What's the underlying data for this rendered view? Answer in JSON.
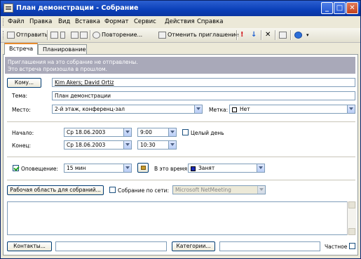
{
  "window": {
    "title": "План демонстрации - Собрание",
    "controls": [
      "_",
      "□",
      "✕"
    ]
  },
  "menu": [
    "Файл",
    "Правка",
    "Вид",
    "Вставка",
    "Формат",
    "Сервис",
    "Действия",
    "Справка"
  ],
  "toolbar": {
    "send": "Отправить",
    "recurrence": "Повторение...",
    "cancel_invite": "Отменить приглашение"
  },
  "tabs": [
    "Встреча",
    "Планирование"
  ],
  "infobar": {
    "line1": "Приглашения на это собрание не отправлены.",
    "line2": "Это встреча произошла в прошлом."
  },
  "form": {
    "to_button": "Кому...",
    "to_value": "Kim Akers; David Ortiz",
    "subject_label": "Тема:",
    "subject_value": "План демонстрации",
    "location_label": "Место:",
    "location_value": "2-й этаж, конференц-зал",
    "label_label": "Метка:",
    "label_value": "Нет",
    "start_label": "Начало:",
    "start_date": "Ср 18.06.2003",
    "start_time": "9:00",
    "all_day": "Целый день",
    "end_label": "Конец:",
    "end_date": "Ср 18.06.2003",
    "end_time": "10:30",
    "reminder_label": "Оповещение:",
    "reminder_value": "15 мин",
    "show_as_label": "В это время:",
    "show_as_value": "Занят",
    "show_as_color": "#1b2bb8",
    "workspace_button": "Рабочая область для собраний...",
    "online_meeting": "Собрание по сети:",
    "online_value": "Microsoft NetMeeting",
    "contacts_button": "Контакты...",
    "categories_button": "Категории...",
    "private_label": "Частное"
  }
}
